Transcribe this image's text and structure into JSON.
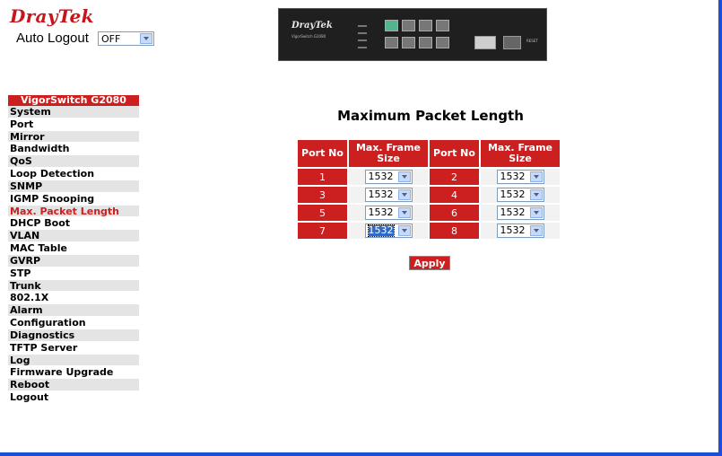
{
  "brand": {
    "logo": "DrayTek"
  },
  "auto_logout": {
    "label": "Auto Logout",
    "value": "OFF"
  },
  "device": {
    "logo": "DrayTek",
    "model": "VigorSwitch G2080",
    "reset": "RESET"
  },
  "sidebar": {
    "header": "VigorSwitch G2080",
    "items": [
      {
        "label": "System"
      },
      {
        "label": "Port"
      },
      {
        "label": "Mirror"
      },
      {
        "label": "Bandwidth"
      },
      {
        "label": "QoS"
      },
      {
        "label": "Loop Detection"
      },
      {
        "label": "SNMP"
      },
      {
        "label": "IGMP Snooping"
      },
      {
        "label": "Max. Packet Length"
      },
      {
        "label": "DHCP Boot"
      },
      {
        "label": "VLAN"
      },
      {
        "label": "MAC Table"
      },
      {
        "label": "GVRP"
      },
      {
        "label": "STP"
      },
      {
        "label": "Trunk"
      },
      {
        "label": "802.1X"
      },
      {
        "label": "Alarm"
      },
      {
        "label": "Configuration"
      },
      {
        "label": "Diagnostics"
      },
      {
        "label": "TFTP Server"
      },
      {
        "label": "Log"
      },
      {
        "label": "Firmware Upgrade"
      },
      {
        "label": "Reboot"
      },
      {
        "label": "Logout"
      }
    ],
    "active_index": 8
  },
  "main": {
    "title": "Maximum Packet Length",
    "headers": {
      "port_no": "Port No",
      "frame_size": "Max. Frame Size"
    },
    "rows": [
      {
        "left_port": "1",
        "left_size": "1532",
        "right_port": "2",
        "right_size": "1532"
      },
      {
        "left_port": "3",
        "left_size": "1532",
        "right_port": "4",
        "right_size": "1532"
      },
      {
        "left_port": "5",
        "left_size": "1532",
        "right_port": "6",
        "right_size": "1532"
      },
      {
        "left_port": "7",
        "left_size": "1532",
        "right_port": "8",
        "right_size": "1532"
      }
    ],
    "apply_label": "Apply"
  },
  "colors": {
    "accent": "#cc1f1f",
    "selection": "#316ac5",
    "frame": "#1c4fd6"
  }
}
